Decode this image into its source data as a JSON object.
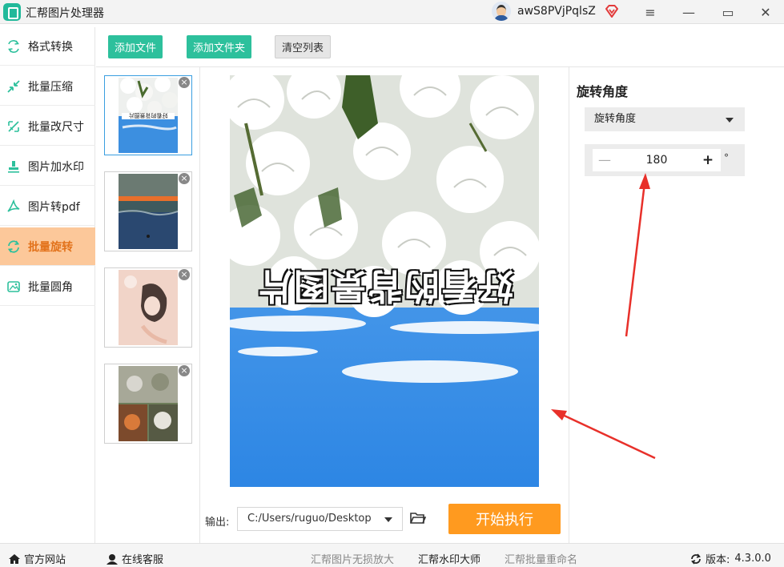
{
  "app": {
    "title": "汇帮图片处理器",
    "username": "awS8PVjPqlsZ",
    "menu_symbol": "≡",
    "minimize_symbol": "—",
    "maximize_symbol": "▭",
    "close_symbol": "✕"
  },
  "colors": {
    "accent_green": "#2dc09c",
    "active_bg": "#fcc89a",
    "active_text": "#e2721b",
    "start_button": "#ff9a1f",
    "annotation_arrow": "#e8302a"
  },
  "sidebar": {
    "items": [
      {
        "label": "格式转换",
        "icon": "format-convert-icon",
        "active": false
      },
      {
        "label": "批量压缩",
        "icon": "compress-icon",
        "active": false
      },
      {
        "label": "批量改尺寸",
        "icon": "resize-icon",
        "active": false
      },
      {
        "label": "图片加水印",
        "icon": "watermark-icon",
        "active": false
      },
      {
        "label": "图片转pdf",
        "icon": "pdf-icon",
        "active": false
      },
      {
        "label": "批量旋转",
        "icon": "rotate-icon",
        "active": true
      },
      {
        "label": "批量圆角",
        "icon": "round-corner-icon",
        "active": false
      }
    ]
  },
  "toolbar": {
    "add_file": "添加文件",
    "add_folder": "添加文件夹",
    "clear_list": "清空列表"
  },
  "thumbnails": {
    "remove_symbol": "×",
    "items": [
      {
        "subject": "roses-and-sky-rotated",
        "selected": true
      },
      {
        "subject": "lake-sunset-reflection",
        "selected": false
      },
      {
        "subject": "girl-portrait",
        "selected": false
      },
      {
        "subject": "cats-collage",
        "selected": false
      }
    ]
  },
  "preview": {
    "overlay_text": "好看的背景图片"
  },
  "output": {
    "label": "输出:",
    "path": "C:/Users/ruguo/Desktop",
    "start_button": "开始执行"
  },
  "settings": {
    "title": "旋转角度",
    "angle_dropdown": "旋转角度",
    "minus": "—",
    "plus": "+",
    "angle_value": "180",
    "unit": "°"
  },
  "footer": {
    "website": "官方网站",
    "support": "在线客服",
    "links": [
      "汇帮图片无损放大",
      "汇帮水印大师",
      "汇帮批量重命名"
    ],
    "version_label": "版本:",
    "version_value": "4.3.0.0"
  }
}
